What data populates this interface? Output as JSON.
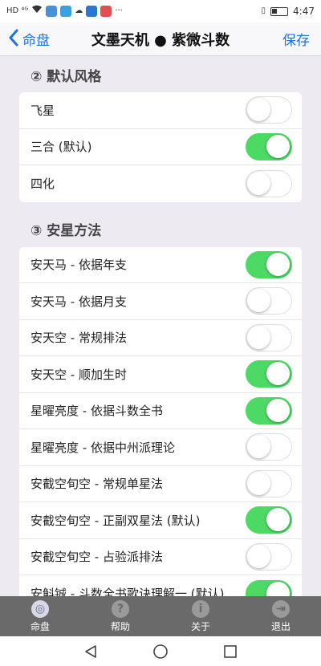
{
  "statusbar": {
    "left_indicators": "HD ⁴ᴳ",
    "time": "4:47"
  },
  "navbar": {
    "back_label": "命盘",
    "title": "文墨天机 ● 紫微斗数",
    "save_label": "保存"
  },
  "sections": [
    {
      "title": "② 默认风格",
      "items": [
        {
          "label": "飞星",
          "on": false
        },
        {
          "label": "三合 (默认)",
          "on": true
        },
        {
          "label": "四化",
          "on": false
        }
      ]
    },
    {
      "title": "③ 安星方法",
      "items": [
        {
          "label": "安天马 - 依据年支",
          "on": true
        },
        {
          "label": "安天马 - 依据月支",
          "on": false
        },
        {
          "label": "安天空 - 常规排法",
          "on": false
        },
        {
          "label": "安天空 - 顺加生时",
          "on": true
        },
        {
          "label": "星曜亮度 - 依据斗数全书",
          "on": true
        },
        {
          "label": "星曜亮度 - 依据中州派理论",
          "on": false
        },
        {
          "label": "安截空旬空 - 常规单星法",
          "on": false
        },
        {
          "label": "安截空旬空 - 正副双星法 (默认)",
          "on": true
        },
        {
          "label": "安截空旬空 - 占验派排法",
          "on": false
        },
        {
          "label": "安斛铖 - 斗数全书歌诀理解一 (默认)",
          "on": true
        }
      ]
    }
  ],
  "tabbar": {
    "tabs": [
      {
        "label": "命盘",
        "icon": "chart-icon",
        "active": true
      },
      {
        "label": "帮助",
        "icon": "help-icon",
        "active": false
      },
      {
        "label": "关于",
        "icon": "info-icon",
        "active": false
      },
      {
        "label": "退出",
        "icon": "exit-icon",
        "active": false
      }
    ]
  },
  "colors": {
    "accent": "#1a73e8",
    "toggle_on": "#4cd964",
    "tabbar_bg": "#6a6a6a"
  }
}
